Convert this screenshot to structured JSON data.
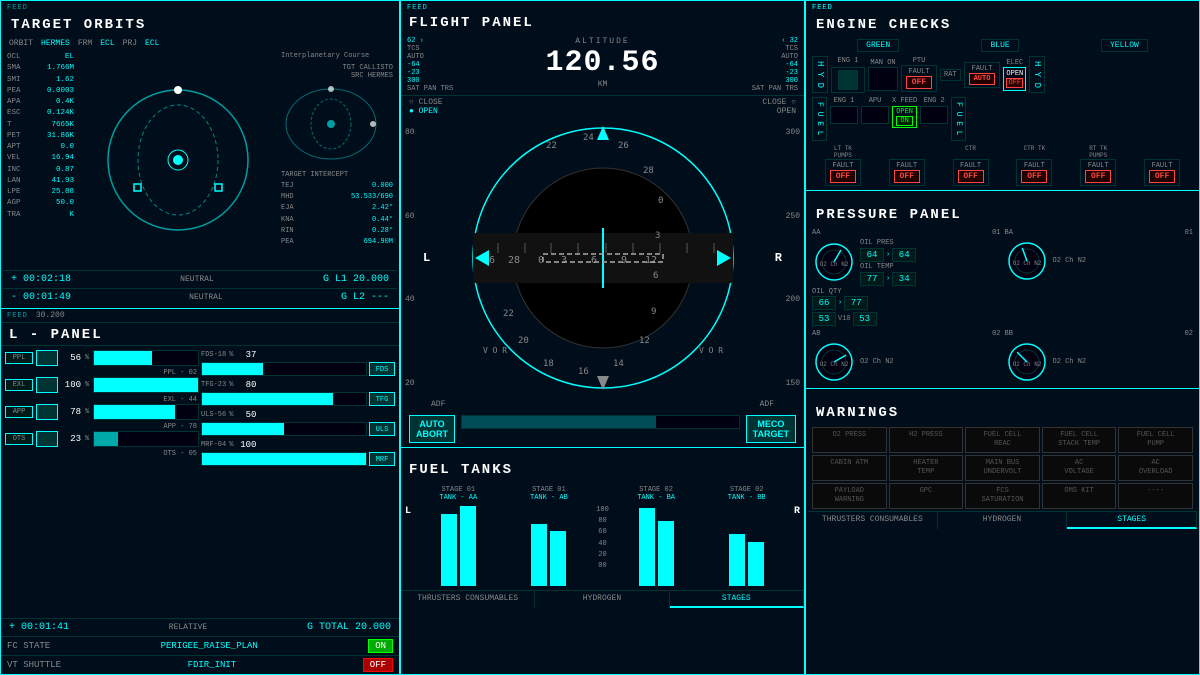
{
  "left": {
    "feed": "FEED",
    "title": "TARGET ORBITS",
    "orbit_header": {
      "orbit_label": "ORBIT",
      "orbit_val": "HERMES",
      "frm_label": "FRM",
      "frm_val": "ECL",
      "prj_label": "PRJ",
      "prj_val": "ECL"
    },
    "orbit_data": [
      {
        "label": "OCL",
        "val": "EL"
      },
      {
        "label": "SMA",
        "val": "1.766M"
      },
      {
        "label": "SMI",
        "val": "1.62"
      },
      {
        "label": "PEA",
        "val": "0.0003"
      },
      {
        "label": "APA",
        "val": "0.4K"
      },
      {
        "label": "ESC",
        "val": "0.124K"
      },
      {
        "label": "T",
        "val": "7665K"
      },
      {
        "label": "PET",
        "val": "31.86K"
      },
      {
        "label": "APT",
        "val": "0.0"
      },
      {
        "label": "VEL",
        "val": "16.94"
      },
      {
        "label": "INC",
        "val": "0.87"
      },
      {
        "label": "LAN",
        "val": "41.93"
      },
      {
        "label": "LPE",
        "val": "25.88"
      },
      {
        "label": "AGP",
        "val": "50.0"
      },
      {
        "label": "TRA",
        "val": "K"
      }
    ],
    "interplanetary": {
      "label": "Interplanetary Course",
      "tgt_label": "TGT CALLISTO",
      "src_label": "SRC HERMES"
    },
    "target_intercept": {
      "label": "TARGET INTERCEPT",
      "rows": [
        {
          "label": "TEJ",
          "val": "0.000"
        },
        {
          "label": "MHD",
          "val": "53.533/690"
        },
        {
          "label": "EJA",
          "val": "2.42"
        },
        {
          "label": "KNA",
          "val": "0.44"
        },
        {
          "label": "RIN",
          "val": "0.28"
        },
        {
          "label": "PEA",
          "val": "694.90M"
        }
      ]
    },
    "time1": {
      "val": "+ 00:02:18",
      "label": "NEUTRAL",
      "g_label": "G L1",
      "g_val": "20.000"
    },
    "time2": {
      "val": "- 00:01:49",
      "label": "NEUTRAL",
      "g_label": "G L2",
      "g_val": "---"
    },
    "l_panel": {
      "feed": "FEED",
      "title": "L - PANEL",
      "sub": "30.200",
      "gauges_left": [
        {
          "label": "PPL",
          "pct": "56",
          "pct_label": "%",
          "tag": "PPL - 02",
          "val": 56
        },
        {
          "label": "EXL",
          "pct": "100",
          "pct_label": "%",
          "tag": "EXL - 44",
          "val": 100
        },
        {
          "label": "APP",
          "pct": "78",
          "pct_label": "%",
          "tag": "APP - 78",
          "val": 78
        },
        {
          "label": "OTS",
          "pct": "23",
          "pct_label": "%",
          "tag": "OTS - 05",
          "val": 23
        }
      ],
      "gauges_right": [
        {
          "label": "FDS",
          "num": "FDS-18",
          "pct": "37",
          "val": 37,
          "tag": "FDS"
        },
        {
          "label": "TFG",
          "num": "TFG-23",
          "pct": "80",
          "val": 80,
          "tag": "TFG"
        },
        {
          "label": "ULS",
          "num": "ULS-56",
          "pct": "50",
          "val": 50,
          "tag": "ULS"
        },
        {
          "label": "MRF",
          "num": "MRF-04",
          "pct": "100",
          "val": 100,
          "tag": "MRF"
        }
      ],
      "bottom_time": {
        "val": "+ 00:01:41",
        "label": "RELATIVE"
      },
      "g_total": {
        "label": "G TOTAL",
        "val": "20.000"
      },
      "fc_state": {
        "label": "FC STATE",
        "val": "PERIGEE_RAISE_PLAN",
        "status": "ON"
      },
      "vt_shuttle": {
        "label": "VT SHUTTLE",
        "val": "FDIR_INIT",
        "status": "OFF"
      }
    }
  },
  "center": {
    "feed": "FEED",
    "title": "FLIGHT PANEL",
    "altitude": {
      "label": "ALTITUDE",
      "val": "120.56",
      "unit": "KM"
    },
    "flight_data": {
      "left": [
        {
          "label": "TCS",
          "val": "62"
        },
        {
          "label": "AUTO",
          "val": ""
        },
        {
          "label": "",
          "val": "-23"
        },
        {
          "label": "",
          "val": "300"
        },
        {
          "label": "SAT",
          "val": "-64"
        },
        {
          "label": "PAN",
          "val": "-23"
        },
        {
          "label": "TRS",
          "val": "300"
        }
      ],
      "right": [
        {
          "label": "SAT",
          "val": "-64"
        },
        {
          "label": "PAN",
          "val": "-23"
        },
        {
          "label": "TRS",
          "val": "300"
        },
        {
          "label": "TCS",
          "val": "32"
        },
        {
          "label": "AUTO",
          "val": ""
        }
      ]
    },
    "close_open": {
      "left_close": "CLOSE",
      "left_open": "OPEN",
      "right_close": "CLOSE",
      "right_open": "OPEN"
    },
    "compass": {
      "numbers": [
        "26",
        "28",
        "0",
        "3",
        "6",
        "9",
        "12"
      ],
      "range_start": 20,
      "range_end": 40,
      "altitude_marks": [
        300,
        250,
        200,
        150
      ]
    },
    "vor_labels": [
      "V O R",
      "V O R"
    ],
    "adf_labels": [
      "ADF",
      "ADF"
    ],
    "auto_abort": "AUTO\nABORT",
    "meco_target": "MECO\nTARGET",
    "fuel_tanks": {
      "feed": "FEED",
      "title": "FUEL TANKS",
      "stages": [
        {
          "stage": "STAGE 01",
          "tank": "TANK - AA",
          "bars": [
            85,
            90
          ]
        },
        {
          "stage": "STAGE 01",
          "tank": "TANK - AB",
          "bars": [
            75,
            70
          ]
        },
        {
          "stage": "%",
          "tank": "",
          "labels": [
            "100",
            "80",
            "60",
            "40",
            "20",
            "00"
          ]
        },
        {
          "stage": "STAGE 02",
          "tank": "TANK - BA",
          "bars": [
            95,
            80
          ]
        },
        {
          "stage": "STAGE 02",
          "tank": "TANK - BB",
          "bars": [
            65,
            55
          ]
        }
      ]
    },
    "bottom_tabs": [
      {
        "label": "THRUSTERS CONSUMABLES",
        "active": false
      },
      {
        "label": "HYDROGEN",
        "active": false
      },
      {
        "label": "STAGES",
        "active": true
      }
    ]
  },
  "right": {
    "engine": {
      "feed": "FEED",
      "title": "ENGINE CHECKS",
      "col_labels": [
        "GREEN",
        "BLUE",
        "YELLOW"
      ],
      "eng1_label": "ENG 1",
      "man_on": "MAN ON",
      "ptu_label": "PTU",
      "fault_off": "FAULT\nOFF",
      "rat_label": "RAT",
      "fault_auto": "FAULT\nAUTO",
      "elec_label": "ELEC",
      "open_off": "OPEN\nOFF",
      "hyd_labels": [
        "H Y D",
        "H Y D"
      ],
      "fuel_label": "F U E L",
      "eng1_fuel": "ENG 1",
      "apu_label": "APU",
      "xfeed": "X FEED",
      "open_label": "OPEN",
      "on_label": "ON",
      "eng2_label": "ENG 2",
      "fuel_rows": [
        {
          "label": "LT TK",
          "sub": "PUMPS",
          "fault": "FAULT OFF"
        },
        {
          "label": "CTR",
          "fault": "FAULT OFF"
        },
        {
          "label": "CTR TK",
          "sub": "",
          "fault": "FAULT OFF"
        },
        {
          "label": "RT TK",
          "sub": "PUMPS",
          "fault": "FAULT OFF"
        }
      ]
    },
    "pressure": {
      "feed": "FEED",
      "title": "PRESSURE PANEL",
      "groups": [
        {
          "id": "AA",
          "num": "01",
          "readings": [
            {
              "label": "OIL PRES",
              "in": "64",
              "out": "64"
            },
            {
              "label": "OIL TEMP",
              "in": "77",
              "out": "34"
            },
            {
              "label": "OIL QTY",
              "in": "66",
              "out": "77"
            }
          ],
          "bottom_in": "53",
          "bottom_label": "V10",
          "bottom_out": "53",
          "gas_labels": "O2  Ch  N2"
        },
        {
          "id": "AB",
          "num": "02",
          "readings": [],
          "gas_labels": "O2  Ch  N2"
        },
        {
          "id": "BA",
          "num": "01",
          "readings": [],
          "gas_labels": "O2  Ch  N2"
        },
        {
          "id": "BB",
          "num": "02",
          "readings": [],
          "gas_labels": "O2  Ch  N2"
        }
      ]
    },
    "warnings": {
      "feed": "FEED",
      "title": "WARNINGS",
      "items": [
        {
          "label": "O2 PRESS",
          "active": false
        },
        {
          "label": "H2 PRESS",
          "active": false
        },
        {
          "label": "FUEL CELL\nREAC",
          "active": false
        },
        {
          "label": "FUEL CELL\nSTACK TEMP",
          "active": false
        },
        {
          "label": "FUEL CELL\nPUMP",
          "active": false
        },
        {
          "label": "CABIN ATM",
          "active": false
        },
        {
          "label": "HEATER\nTEMP",
          "active": false
        },
        {
          "label": "MAIN BUS\nUNDERVOLT",
          "active": false
        },
        {
          "label": "AC\nVOLTAGE",
          "active": false
        },
        {
          "label": "AC\nOVERLOAD",
          "active": false
        },
        {
          "label": "PAYLOAD\nWARNING",
          "active": false
        },
        {
          "label": "GPC",
          "active": false
        },
        {
          "label": "FCS\nSATURATION",
          "active": false
        },
        {
          "label": "OMS KIT",
          "active": false
        },
        {
          "label": "----",
          "active": false
        }
      ]
    },
    "bottom_tabs": [
      {
        "label": "THRUSTERS CONSUMABLES",
        "active": false
      },
      {
        "label": "HYDROGEN",
        "active": false
      },
      {
        "label": "STAGES",
        "active": true
      }
    ]
  }
}
